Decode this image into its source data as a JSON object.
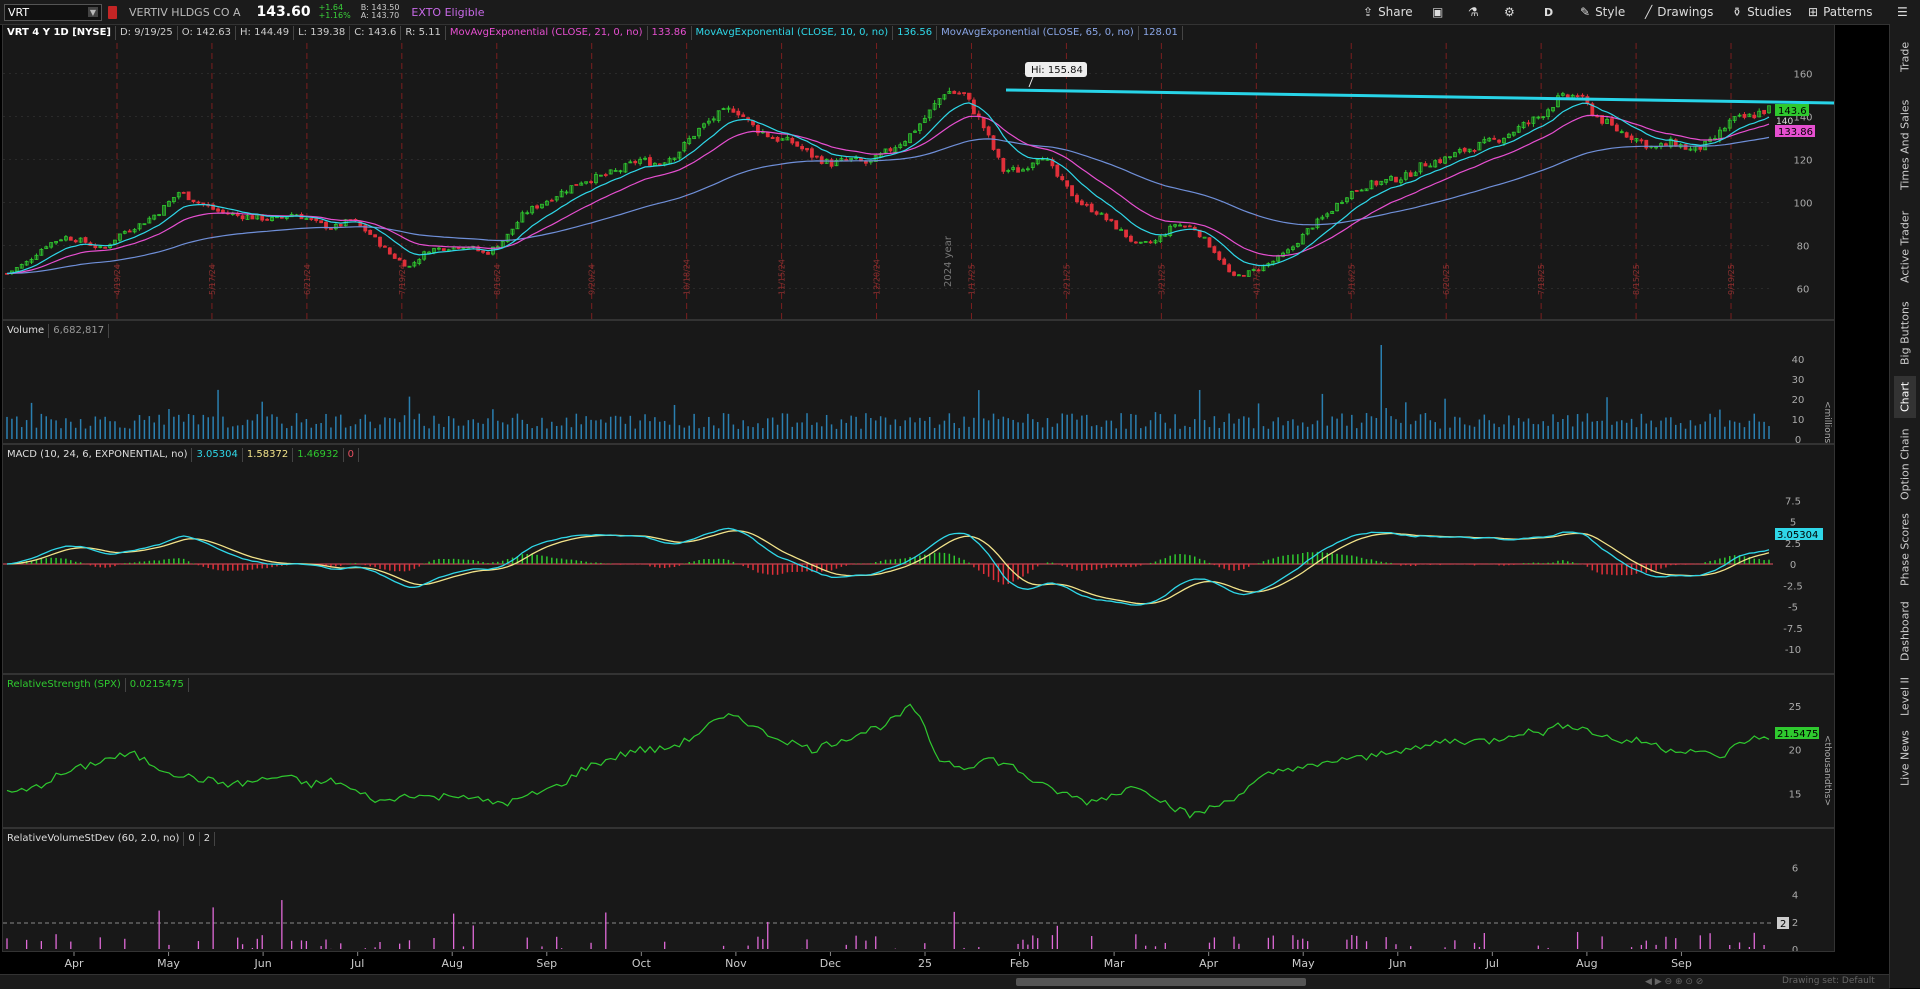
{
  "header": {
    "symbol": "VRT",
    "company": "VERTIV HLDGS CO A",
    "last": "143.60",
    "change_abs": "+1.64",
    "change_pct": "+1.16%",
    "bid": "B: 143.50",
    "ask": "A: 143.70",
    "exto": "EXTO Eligible"
  },
  "toolbar": {
    "share": "Share",
    "period": "D",
    "style": "Style",
    "drawings": "Drawings",
    "studies": "Studies",
    "patterns": "Patterns"
  },
  "price_panel": {
    "title": "VRT 4 Y 1D [NYSE]",
    "date": "D: 9/19/25",
    "open": "O: 142.63",
    "high": "H: 144.49",
    "low": "L: 139.38",
    "close": "C: 143.6",
    "range": "R: 5.11",
    "ema21_label": "MovAvgExponential (CLOSE, 21, 0, no)",
    "ema21_value": "133.86",
    "ema10_label": "MovAvgExponential (CLOSE, 10, 0, no)",
    "ema10_value": "136.56",
    "ema65_label": "MovAvgExponential (CLOSE, 65, 0, no)",
    "ema65_value": "128.01",
    "hi_label": "Hi: 155.84",
    "last_tag": "143.6",
    "ema_tag": "133.86",
    "ema_tag2": "140",
    "year_marker": "2024 year",
    "y_ticks": [
      "160",
      "140",
      "120",
      "100",
      "80",
      "60"
    ],
    "earnings_dates": [
      "4/19/24",
      "5/17/24",
      "6/21/24",
      "7/19/24",
      "8/16/24",
      "9/20/24",
      "10/18/24",
      "11/15/24",
      "12/20/24",
      "1/17/25",
      "2/21/25",
      "3/21/25",
      "4/17/25",
      "5/16/25",
      "6/20/25",
      "7/18/25",
      "8/15/25",
      "9/19/25"
    ],
    "colors": {
      "up": "#2fc92f",
      "down": "#e0303a",
      "ema10": "#2fd7e8",
      "ema21": "#e64fd0",
      "ema65": "#6f8fd8",
      "trendline": "#28d4e8"
    }
  },
  "volume_panel": {
    "label": "Volume",
    "value": "6,682,817",
    "y_ticks": [
      "40",
      "30",
      "20",
      "10",
      "0"
    ],
    "unit": "<millions>"
  },
  "macd_panel": {
    "label": "MACD (10, 24, 6, EXPONENTIAL, no)",
    "value": "3.05304",
    "avg": "1.58372",
    "diff": "1.46932",
    "zero": "0",
    "tag": "3.05304",
    "y_ticks": [
      "7.5",
      "5",
      "2.5",
      "0",
      "-2.5",
      "-5",
      "-7.5",
      "-10"
    ]
  },
  "rs_panel": {
    "label": "RelativeStrength (SPX)",
    "value": "0.0215475",
    "tag": "21.5475",
    "y_ticks": [
      "25",
      "20",
      "15"
    ],
    "unit": "<thousandths>"
  },
  "rv_panel": {
    "label": "RelativeVolumeStDev (60, 2.0, no)",
    "v1": "0",
    "v2": "2",
    "tag": "2",
    "y_ticks": [
      "6",
      "4",
      "2",
      "0"
    ]
  },
  "x_axis": [
    "Apr",
    "May",
    "Jun",
    "Jul",
    "Aug",
    "Sep",
    "Oct",
    "Nov",
    "Dec",
    "25",
    "Feb",
    "Mar",
    "Apr",
    "May",
    "Jun",
    "Jul",
    "Aug",
    "Sep"
  ],
  "side_tabs": [
    "Trade",
    "Times And Sales",
    "Active Trader",
    "Big Buttons",
    "Chart",
    "Option Chain",
    "Phase Scores",
    "Dashboard",
    "Level II",
    "Live News"
  ],
  "status": {
    "drawing_set": "Drawing set: Default"
  },
  "chart_data": {
    "type": "line",
    "series": [
      {
        "name": "VRT",
        "values": [
          67,
          72,
          80,
          84,
          82,
          78,
          86,
          90,
          96,
          105,
          100,
          96,
          94,
          93,
          92,
          95,
          91,
          88,
          92,
          85,
          76,
          70,
          78,
          79,
          80,
          76,
          83,
          95,
          100,
          105,
          110,
          112,
          115,
          120,
          118,
          123,
          133,
          140,
          144,
          135,
          130,
          128,
          122,
          118,
          120,
          118,
          124,
          130,
          140,
          152,
          150,
          135,
          115,
          115,
          123,
          110,
          100,
          95,
          88,
          80,
          82,
          90,
          88,
          78,
          65,
          68,
          72,
          78,
          88,
          95,
          104,
          108,
          110,
          112,
          118,
          120,
          124,
          127,
          130,
          135,
          140,
          148,
          150,
          140,
          134,
          130,
          125,
          128,
          124,
          128,
          138,
          140,
          143.6
        ]
      },
      {
        "name": "RelativeStrength (SPX)",
        "values": [
          15,
          15.5,
          17,
          18,
          19,
          19.5,
          18,
          17,
          16.5,
          16,
          16.5,
          17,
          16,
          16.5,
          15,
          14,
          15,
          14.5,
          15,
          14,
          14,
          15,
          16,
          18,
          19,
          20,
          20,
          21,
          23,
          24,
          22,
          21,
          20,
          21,
          22,
          23,
          25,
          19,
          18,
          19,
          18,
          16,
          15,
          14,
          15,
          16,
          14,
          12.5,
          13.5,
          15,
          17,
          18,
          18,
          19,
          19,
          20,
          20,
          21,
          21,
          21,
          22,
          22,
          23,
          22,
          21,
          21,
          20,
          20,
          19,
          21,
          21.5475
        ]
      }
    ],
    "ylim": [
      50,
      170
    ],
    "annotations": [
      "Hi: 155.84"
    ]
  }
}
